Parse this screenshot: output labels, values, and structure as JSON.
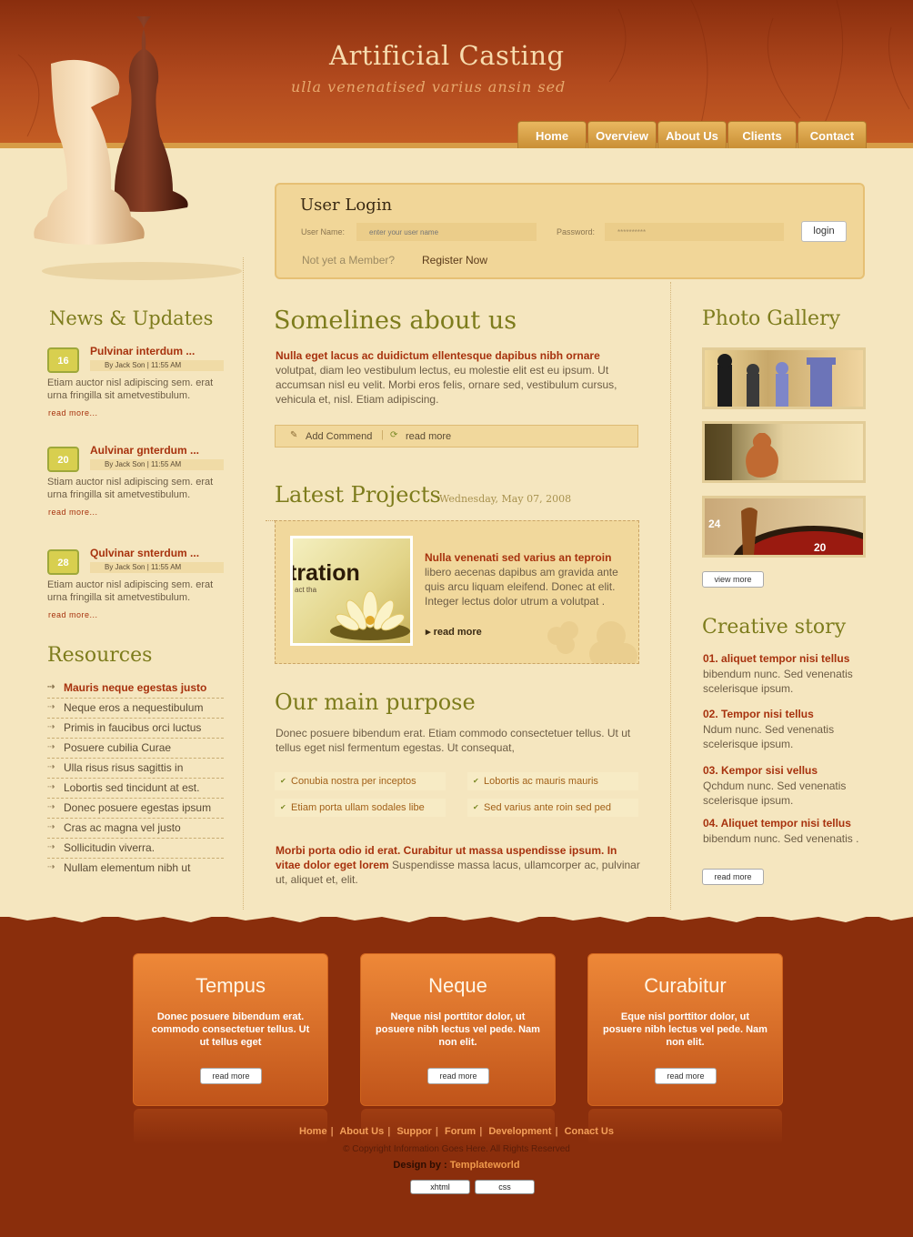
{
  "header": {
    "title": "Artificial Casting",
    "tagline": "ulla venenatised varius ansin sed",
    "nav": [
      "Home",
      "Overview",
      "About Us",
      "Clients",
      "Contact"
    ]
  },
  "login": {
    "heading": "User Login",
    "username_label": "User Name:",
    "username_placeholder": "enter your user name",
    "password_label": "Password:",
    "password_value": "**********",
    "button": "login",
    "not_member": "Not yet a Member?",
    "register": "Register Now"
  },
  "news": {
    "heading": "News & Updates",
    "items": [
      {
        "day": "16",
        "title": "Pulvinar interdum ...",
        "by": "By Jack Son  | 11:55 AM",
        "body": "Etiam auctor nisl adipiscing sem.  erat urna fringilla sit ametvestibulum.",
        "more": "read more..."
      },
      {
        "day": "20",
        "title": "Aulvinar gnterdum ...",
        "by": "By Jack Son  | 11:55 AM",
        "body": "Stiam auctor nisl adipiscing sem.  erat urna fringilla sit ametvestibulum.",
        "more": "read more..."
      },
      {
        "day": "28",
        "title": "Qulvinar snterdum ...",
        "by": "By Jack Son  | 11:55 AM",
        "body": "Etiam auctor nisl adipiscing sem.  erat urna fringilla sit ametvestibulum.",
        "more": "read more..."
      }
    ]
  },
  "resources": {
    "heading": "Resources",
    "items": [
      "Mauris neque egestas justo",
      "Neque eros a nequestibulum",
      "Primis in faucibus orci luctus",
      "Posuere cubilia Curae",
      "Ulla risus risus sagittis in",
      "Lobortis sed tincidunt at est.",
      "Donec posuere egestas ipsum",
      "Cras ac magna vel justo",
      "Sollicitudin viverra.",
      "Nullam elementum nibh ut"
    ]
  },
  "about": {
    "heading": "Somelines about us",
    "lead": "Nulla eget lacus ac duidictum ellentesque dapibus nibh ornare",
    "body": "volutpat, diam leo vestibulum lectus, eu molestie elit est eu ipsum. Ut accumsan nisl eu velit. Morbi eros felis, ornare sed, vestibulum cursus, vehicula et, nisl. Etiam adipiscing.",
    "add_comment": "Add Commend",
    "read_more": "read more"
  },
  "projects": {
    "heading": "Latest Projects",
    "date": "Wednesday, May 07, 2008",
    "image_text": "tration",
    "image_sub": "act tha",
    "title": "Nulla venenati sed varius an teproin",
    "body": "libero aecenas dapibus am gravida ante quis arcu liquam eleifend. Donec at elit. Integer lectus dolor utrum a volutpat .",
    "read_more": "read more"
  },
  "purpose": {
    "heading": "Our main purpose",
    "body": "Donec posuere bibendum erat. Etiam commodo consectetuer tellus. Ut ut tellus eget nisl fermentum egestas. Ut consequat,",
    "bullets": [
      "Conubia nostra per inceptos",
      "Lobortis ac mauris mauris",
      "Etiam porta ullam sodales libe",
      "Sed varius ante roin sed ped"
    ],
    "lead": "Morbi porta odio id erat. Curabitur ut massa uspendisse ipsum. In vitae dolor eget lorem",
    "tail": " Suspendisse massa lacus, ullamcorper ac, pulvinar ut, aliquet et, elit."
  },
  "gallery": {
    "heading": "Photo Gallery",
    "button": "view more"
  },
  "story": {
    "heading": "Creative story",
    "items": [
      {
        "title": "01. aliquet tempor nisi tellus",
        "body": "bibendum nunc. Sed venenatis scelerisque ipsum."
      },
      {
        "title": "02.  Tempor nisi tellus",
        "body": "Ndum nunc. Sed venenatis scelerisque ipsum."
      },
      {
        "title": "03.  Kempor sisi vellus",
        "body": "Qchdum nunc. Sed venenatis scelerisque ipsum."
      },
      {
        "title": "04. Aliquet tempor nisi tellus",
        "body": "bibendum nunc. Sed venenatis ."
      }
    ],
    "button": "read more"
  },
  "footer_boxes": [
    {
      "title": "Tempus",
      "body": "Donec posuere bibendum erat. commodo consectetuer tellus. Ut ut tellus eget",
      "button": "read more"
    },
    {
      "title": "Neque",
      "body": "Neque nisl porttitor dolor, ut posuere nibh lectus vel pede. Nam non elit.",
      "button": "read more"
    },
    {
      "title": "Curabitur",
      "body": "Eque nisl porttitor dolor, ut posuere nibh lectus vel pede. Nam non elit.",
      "button": "read more"
    }
  ],
  "footer": {
    "links": [
      "Home",
      "About Us",
      "Suppor",
      "Forum",
      "Development",
      "Conact Us"
    ],
    "copyright": "© Copyright Information Goes Here. All Rights Reserved",
    "design_label": "Design by : ",
    "designer": "Templateworld",
    "badges": [
      "xhtml",
      "css"
    ]
  },
  "colors": {
    "brand_dark": "#8a2e0c",
    "accent_red": "#a7320e",
    "olive": "#7d7c1c",
    "cream": "#f5e6bf",
    "orange": "#ee8838"
  }
}
